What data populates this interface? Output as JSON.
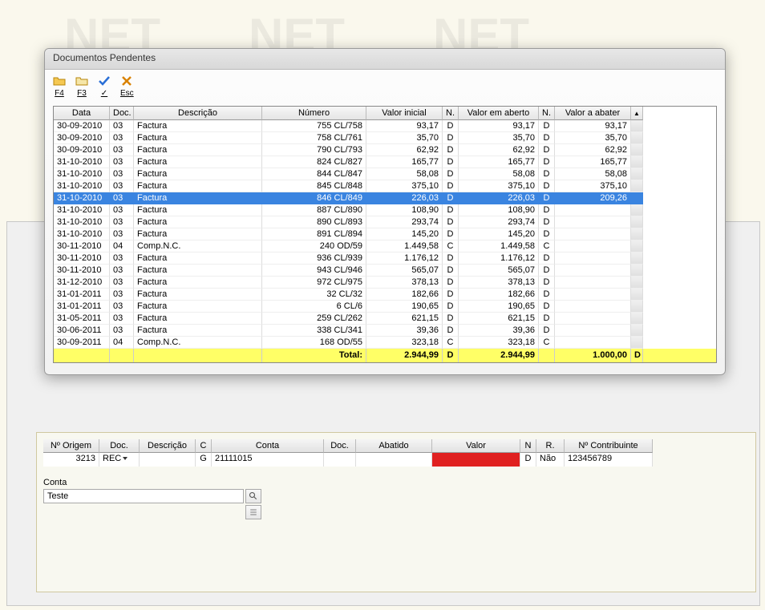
{
  "dialog": {
    "title": "Documentos Pendentes",
    "toolbar": {
      "f4": "F4",
      "f3": "F3",
      "ok": "✓",
      "esc": "Esc"
    },
    "columns": {
      "data": "Data",
      "doc": "Doc.",
      "descricao": "Descrição",
      "numero": "Número",
      "valor_inicial": "Valor inicial",
      "n1": "N.",
      "valor_em_aberto": "Valor em aberto",
      "n2": "N.",
      "valor_a_abater": "Valor a abater"
    },
    "rows": [
      {
        "data": "30-09-2010",
        "doc": "03",
        "desc": "Factura",
        "num": "755 CL/758",
        "vi": "93,17",
        "n1": "D",
        "va": "93,17",
        "n2": "D",
        "vb": "93,17"
      },
      {
        "data": "30-09-2010",
        "doc": "03",
        "desc": "Factura",
        "num": "758 CL/761",
        "vi": "35,70",
        "n1": "D",
        "va": "35,70",
        "n2": "D",
        "vb": "35,70"
      },
      {
        "data": "30-09-2010",
        "doc": "03",
        "desc": "Factura",
        "num": "790 CL/793",
        "vi": "62,92",
        "n1": "D",
        "va": "62,92",
        "n2": "D",
        "vb": "62,92"
      },
      {
        "data": "31-10-2010",
        "doc": "03",
        "desc": "Factura",
        "num": "824 CL/827",
        "vi": "165,77",
        "n1": "D",
        "va": "165,77",
        "n2": "D",
        "vb": "165,77"
      },
      {
        "data": "31-10-2010",
        "doc": "03",
        "desc": "Factura",
        "num": "844 CL/847",
        "vi": "58,08",
        "n1": "D",
        "va": "58,08",
        "n2": "D",
        "vb": "58,08"
      },
      {
        "data": "31-10-2010",
        "doc": "03",
        "desc": "Factura",
        "num": "845 CL/848",
        "vi": "375,10",
        "n1": "D",
        "va": "375,10",
        "n2": "D",
        "vb": "375,10"
      },
      {
        "data": "31-10-2010",
        "doc": "03",
        "desc": "Factura",
        "num": "846 CL/849",
        "vi": "226,03",
        "n1": "D",
        "va": "226,03",
        "n2": "D",
        "vb": "209,26",
        "selected": true
      },
      {
        "data": "31-10-2010",
        "doc": "03",
        "desc": "Factura",
        "num": "887 CL/890",
        "vi": "108,90",
        "n1": "D",
        "va": "108,90",
        "n2": "D",
        "vb": ""
      },
      {
        "data": "31-10-2010",
        "doc": "03",
        "desc": "Factura",
        "num": "890 CL/893",
        "vi": "293,74",
        "n1": "D",
        "va": "293,74",
        "n2": "D",
        "vb": ""
      },
      {
        "data": "31-10-2010",
        "doc": "03",
        "desc": "Factura",
        "num": "891 CL/894",
        "vi": "145,20",
        "n1": "D",
        "va": "145,20",
        "n2": "D",
        "vb": ""
      },
      {
        "data": "30-11-2010",
        "doc": "04",
        "desc": "Comp.N.C.",
        "num": "240 OD/59",
        "vi": "1.449,58",
        "n1": "C",
        "va": "1.449,58",
        "n2": "C",
        "vb": ""
      },
      {
        "data": "30-11-2010",
        "doc": "03",
        "desc": "Factura",
        "num": "936 CL/939",
        "vi": "1.176,12",
        "n1": "D",
        "va": "1.176,12",
        "n2": "D",
        "vb": ""
      },
      {
        "data": "30-11-2010",
        "doc": "03",
        "desc": "Factura",
        "num": "943 CL/946",
        "vi": "565,07",
        "n1": "D",
        "va": "565,07",
        "n2": "D",
        "vb": ""
      },
      {
        "data": "31-12-2010",
        "doc": "03",
        "desc": "Factura",
        "num": "972 CL/975",
        "vi": "378,13",
        "n1": "D",
        "va": "378,13",
        "n2": "D",
        "vb": ""
      },
      {
        "data": "31-01-2011",
        "doc": "03",
        "desc": "Factura",
        "num": "32 CL/32",
        "vi": "182,66",
        "n1": "D",
        "va": "182,66",
        "n2": "D",
        "vb": ""
      },
      {
        "data": "31-01-2011",
        "doc": "03",
        "desc": "Factura",
        "num": "6 CL/6",
        "vi": "190,65",
        "n1": "D",
        "va": "190,65",
        "n2": "D",
        "vb": ""
      },
      {
        "data": "31-05-2011",
        "doc": "03",
        "desc": "Factura",
        "num": "259 CL/262",
        "vi": "621,15",
        "n1": "D",
        "va": "621,15",
        "n2": "D",
        "vb": ""
      },
      {
        "data": "30-06-2011",
        "doc": "03",
        "desc": "Factura",
        "num": "338 CL/341",
        "vi": "39,36",
        "n1": "D",
        "va": "39,36",
        "n2": "D",
        "vb": ""
      },
      {
        "data": "30-09-2011",
        "doc": "04",
        "desc": "Comp.N.C.",
        "num": "168 OD/55",
        "vi": "323,18",
        "n1": "C",
        "va": "323,18",
        "n2": "C",
        "vb": ""
      }
    ],
    "totals": {
      "label": "Total:",
      "vi": "2.944,99",
      "n1": "D",
      "va": "2.944,99",
      "vb": "1.000,00",
      "n3": "D"
    }
  },
  "bottom": {
    "columns": {
      "n_origem": "Nº Origem",
      "doc": "Doc.",
      "descricao": "Descrição",
      "c": "C",
      "conta": "Conta",
      "doc2": "Doc.",
      "abatido": "Abatido",
      "valor": "Valor",
      "n": "N",
      "r": "R.",
      "contrib": "Nº Contribuinte"
    },
    "row": {
      "n_origem": "3213",
      "doc": "REC",
      "descricao": "",
      "c": "G",
      "conta": "21111015",
      "doc2": "",
      "abatido": "",
      "valor": "",
      "n": "D",
      "r": "Não",
      "contrib": "123456789"
    },
    "conta_label": "Conta",
    "conta_value": "Teste"
  }
}
